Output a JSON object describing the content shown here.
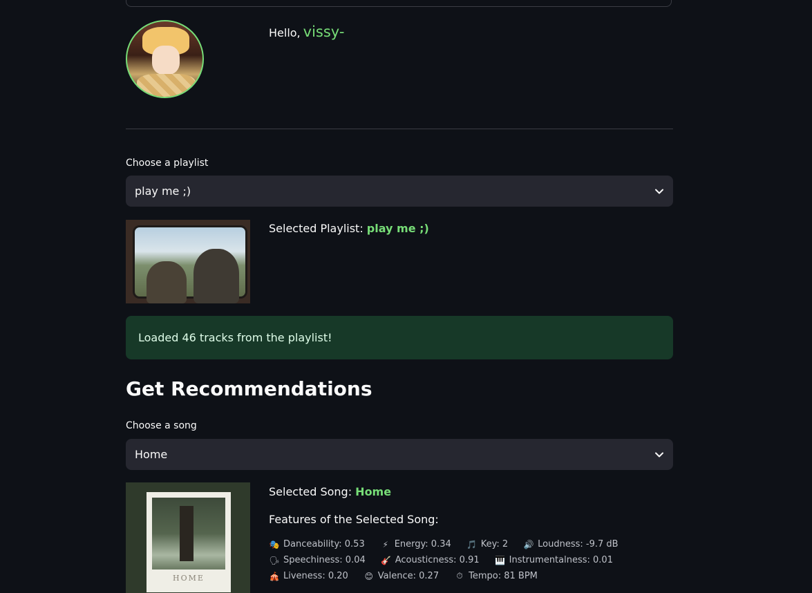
{
  "header": {
    "greeting": "Hello,",
    "username": "vissy-"
  },
  "playlist_section": {
    "label": "Choose a playlist",
    "selected_value": "play me ;)",
    "selected_prefix": "Selected Playlist:",
    "selected_name": "play me ;)"
  },
  "status": {
    "message": "Loaded 46 tracks from the playlist!"
  },
  "recommendations": {
    "heading": "Get Recommendations",
    "song_label": "Choose a song",
    "song_value": "Home",
    "selected_prefix": "Selected Song:",
    "selected_name": "Home",
    "features_title": "Features of the Selected Song:",
    "album_caption": "HOME"
  },
  "features": [
    {
      "icon": "masks-icon",
      "glyph": "🎭",
      "label": "Danceability: 0.53"
    },
    {
      "icon": "lightning-icon",
      "glyph": "⚡",
      "label": "Energy: 0.34"
    },
    {
      "icon": "music-note-icon",
      "glyph": "🎵",
      "label": "Key: 2"
    },
    {
      "icon": "speaker-icon",
      "glyph": "🔊",
      "label": "Loudness: -9.7 dB"
    },
    {
      "icon": "speaking-head-icon",
      "glyph": "🗣",
      "label": "Speechiness: 0.04"
    },
    {
      "icon": "guitar-icon",
      "glyph": "🎸",
      "label": "Acousticness: 0.91"
    },
    {
      "icon": "piano-icon",
      "glyph": "🎹",
      "label": "Instrumentalness: 0.01"
    },
    {
      "icon": "circus-tent-icon",
      "glyph": "🎪",
      "label": "Liveness: 0.20"
    },
    {
      "icon": "smile-icon",
      "glyph": "😊",
      "label": "Valence: 0.27"
    },
    {
      "icon": "stopwatch-icon",
      "glyph": "⏱",
      "label": "Tempo: 81 BPM"
    }
  ],
  "colors": {
    "background": "#0e1117",
    "accent": "#77dd77",
    "select_bg": "#262730",
    "success_bg": "#173928"
  }
}
